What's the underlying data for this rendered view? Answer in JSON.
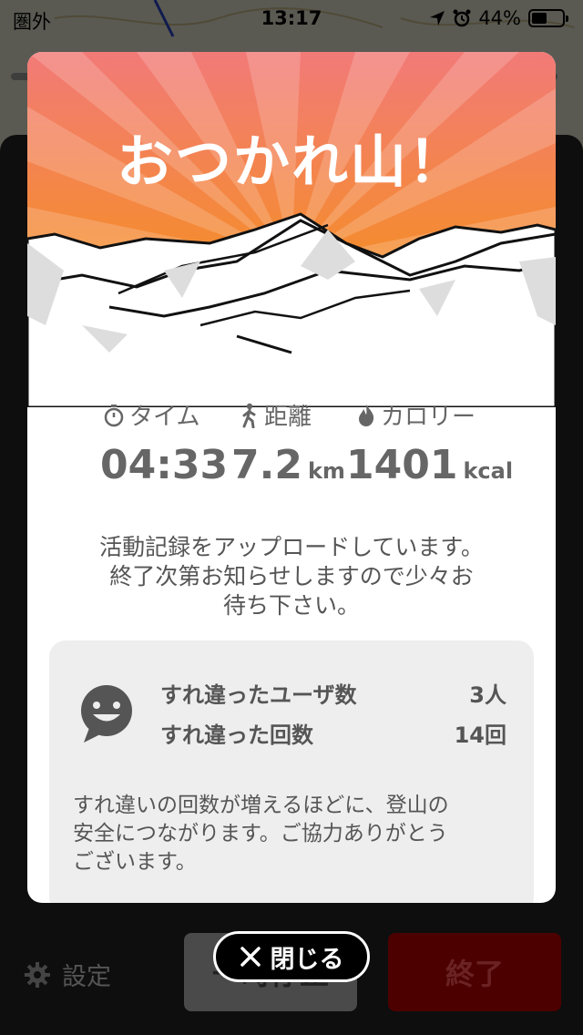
{
  "status_bar": {
    "carrier": "圏外",
    "time": "13:17",
    "battery": "44%"
  },
  "modal": {
    "title": "おつかれ山！",
    "stats": {
      "time": {
        "label": "タイム",
        "value": "04:33",
        "icon": "stopwatch-icon"
      },
      "distance": {
        "label": "距離",
        "value": "7.2",
        "unit": "km",
        "icon": "hiker-icon"
      },
      "calories": {
        "label": "カロリー",
        "value": "1401",
        "unit": "kcal",
        "icon": "flame-icon"
      }
    },
    "upload_message": [
      "活動記録をアップロードしています。",
      "終了次第お知らせしますので少々お",
      "待ち下さい。"
    ],
    "encounters": {
      "users_label": "すれ違ったユーザ数",
      "users_value": "3人",
      "count_label": "すれ違った回数",
      "count_value": "14回",
      "note": [
        "すれ違いの回数が増えるほどに、登山の",
        "安全につながります。ご協力ありがとう",
        "ございます。"
      ]
    }
  },
  "close_button": {
    "label": "閉じる"
  },
  "bottom": {
    "settings_label": "設定",
    "pause_label": "一時停止",
    "end_label": "終了"
  },
  "colors": {
    "banner_top": "#f27a78",
    "banner_bottom": "#f5901f",
    "end_button": "#4d0000"
  }
}
